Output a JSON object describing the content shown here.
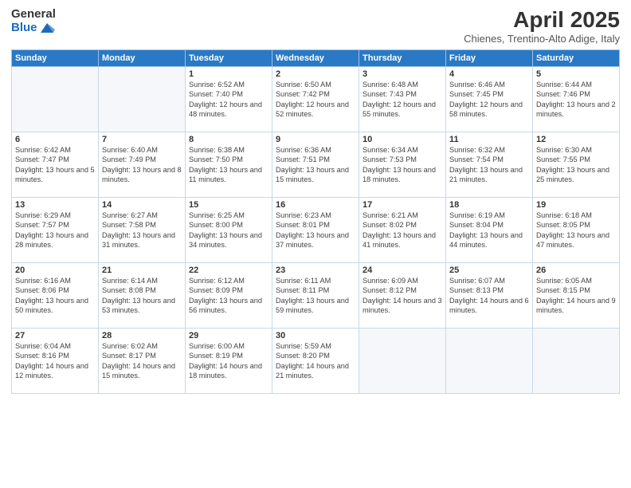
{
  "header": {
    "logo_general": "General",
    "logo_blue": "Blue",
    "title": "April 2025",
    "location": "Chienes, Trentino-Alto Adige, Italy"
  },
  "weekdays": [
    "Sunday",
    "Monday",
    "Tuesday",
    "Wednesday",
    "Thursday",
    "Friday",
    "Saturday"
  ],
  "weeks": [
    [
      {
        "day": "",
        "info": ""
      },
      {
        "day": "",
        "info": ""
      },
      {
        "day": "1",
        "info": "Sunrise: 6:52 AM\nSunset: 7:40 PM\nDaylight: 12 hours and 48 minutes."
      },
      {
        "day": "2",
        "info": "Sunrise: 6:50 AM\nSunset: 7:42 PM\nDaylight: 12 hours and 52 minutes."
      },
      {
        "day": "3",
        "info": "Sunrise: 6:48 AM\nSunset: 7:43 PM\nDaylight: 12 hours and 55 minutes."
      },
      {
        "day": "4",
        "info": "Sunrise: 6:46 AM\nSunset: 7:45 PM\nDaylight: 12 hours and 58 minutes."
      },
      {
        "day": "5",
        "info": "Sunrise: 6:44 AM\nSunset: 7:46 PM\nDaylight: 13 hours and 2 minutes."
      }
    ],
    [
      {
        "day": "6",
        "info": "Sunrise: 6:42 AM\nSunset: 7:47 PM\nDaylight: 13 hours and 5 minutes."
      },
      {
        "day": "7",
        "info": "Sunrise: 6:40 AM\nSunset: 7:49 PM\nDaylight: 13 hours and 8 minutes."
      },
      {
        "day": "8",
        "info": "Sunrise: 6:38 AM\nSunset: 7:50 PM\nDaylight: 13 hours and 11 minutes."
      },
      {
        "day": "9",
        "info": "Sunrise: 6:36 AM\nSunset: 7:51 PM\nDaylight: 13 hours and 15 minutes."
      },
      {
        "day": "10",
        "info": "Sunrise: 6:34 AM\nSunset: 7:53 PM\nDaylight: 13 hours and 18 minutes."
      },
      {
        "day": "11",
        "info": "Sunrise: 6:32 AM\nSunset: 7:54 PM\nDaylight: 13 hours and 21 minutes."
      },
      {
        "day": "12",
        "info": "Sunrise: 6:30 AM\nSunset: 7:55 PM\nDaylight: 13 hours and 25 minutes."
      }
    ],
    [
      {
        "day": "13",
        "info": "Sunrise: 6:29 AM\nSunset: 7:57 PM\nDaylight: 13 hours and 28 minutes."
      },
      {
        "day": "14",
        "info": "Sunrise: 6:27 AM\nSunset: 7:58 PM\nDaylight: 13 hours and 31 minutes."
      },
      {
        "day": "15",
        "info": "Sunrise: 6:25 AM\nSunset: 8:00 PM\nDaylight: 13 hours and 34 minutes."
      },
      {
        "day": "16",
        "info": "Sunrise: 6:23 AM\nSunset: 8:01 PM\nDaylight: 13 hours and 37 minutes."
      },
      {
        "day": "17",
        "info": "Sunrise: 6:21 AM\nSunset: 8:02 PM\nDaylight: 13 hours and 41 minutes."
      },
      {
        "day": "18",
        "info": "Sunrise: 6:19 AM\nSunset: 8:04 PM\nDaylight: 13 hours and 44 minutes."
      },
      {
        "day": "19",
        "info": "Sunrise: 6:18 AM\nSunset: 8:05 PM\nDaylight: 13 hours and 47 minutes."
      }
    ],
    [
      {
        "day": "20",
        "info": "Sunrise: 6:16 AM\nSunset: 8:06 PM\nDaylight: 13 hours and 50 minutes."
      },
      {
        "day": "21",
        "info": "Sunrise: 6:14 AM\nSunset: 8:08 PM\nDaylight: 13 hours and 53 minutes."
      },
      {
        "day": "22",
        "info": "Sunrise: 6:12 AM\nSunset: 8:09 PM\nDaylight: 13 hours and 56 minutes."
      },
      {
        "day": "23",
        "info": "Sunrise: 6:11 AM\nSunset: 8:11 PM\nDaylight: 13 hours and 59 minutes."
      },
      {
        "day": "24",
        "info": "Sunrise: 6:09 AM\nSunset: 8:12 PM\nDaylight: 14 hours and 3 minutes."
      },
      {
        "day": "25",
        "info": "Sunrise: 6:07 AM\nSunset: 8:13 PM\nDaylight: 14 hours and 6 minutes."
      },
      {
        "day": "26",
        "info": "Sunrise: 6:05 AM\nSunset: 8:15 PM\nDaylight: 14 hours and 9 minutes."
      }
    ],
    [
      {
        "day": "27",
        "info": "Sunrise: 6:04 AM\nSunset: 8:16 PM\nDaylight: 14 hours and 12 minutes."
      },
      {
        "day": "28",
        "info": "Sunrise: 6:02 AM\nSunset: 8:17 PM\nDaylight: 14 hours and 15 minutes."
      },
      {
        "day": "29",
        "info": "Sunrise: 6:00 AM\nSunset: 8:19 PM\nDaylight: 14 hours and 18 minutes."
      },
      {
        "day": "30",
        "info": "Sunrise: 5:59 AM\nSunset: 8:20 PM\nDaylight: 14 hours and 21 minutes."
      },
      {
        "day": "",
        "info": ""
      },
      {
        "day": "",
        "info": ""
      },
      {
        "day": "",
        "info": ""
      }
    ]
  ]
}
